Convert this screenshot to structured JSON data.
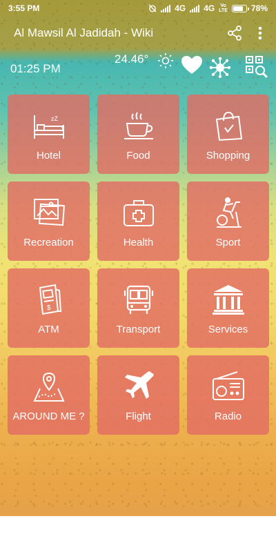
{
  "status_bar": {
    "time": "3:55 PM",
    "network_1": "4G",
    "network_2": "4G",
    "volte_top": "Vo",
    "volte_bottom": "LTE",
    "battery": "78%",
    "battery_level": 0.78
  },
  "app_bar": {
    "title": "Al Mawsil Al Jadidah - Wiki",
    "share_icon": "share-icon",
    "menu_icon": "more-vert-icon"
  },
  "info": {
    "clock": "01:25 PM",
    "temperature": "24.46°",
    "weather_icon": "sun-icon",
    "favorite_icon": "heart-icon",
    "network_icon": "network-icon",
    "qr_icon": "qr-search-icon"
  },
  "tiles": [
    {
      "label": "Hotel",
      "icon": "bed-icon"
    },
    {
      "label": "Food",
      "icon": "coffee-cup-icon"
    },
    {
      "label": "Shopping",
      "icon": "shopping-bag-icon"
    },
    {
      "label": "Recreation",
      "icon": "pictures-icon"
    },
    {
      "label": "Health",
      "icon": "first-aid-icon"
    },
    {
      "label": "Sport",
      "icon": "exercise-bike-icon"
    },
    {
      "label": "ATM",
      "icon": "atm-icon"
    },
    {
      "label": "Transport",
      "icon": "bus-icon"
    },
    {
      "label": "Services",
      "icon": "bank-icon"
    },
    {
      "label": "AROUND ME ?",
      "icon": "map-pin-icon"
    },
    {
      "label": "Flight",
      "icon": "airplane-icon"
    },
    {
      "label": "Radio",
      "icon": "radio-icon"
    }
  ],
  "colors": {
    "tile": "#e26c64",
    "text": "#ffffff"
  }
}
